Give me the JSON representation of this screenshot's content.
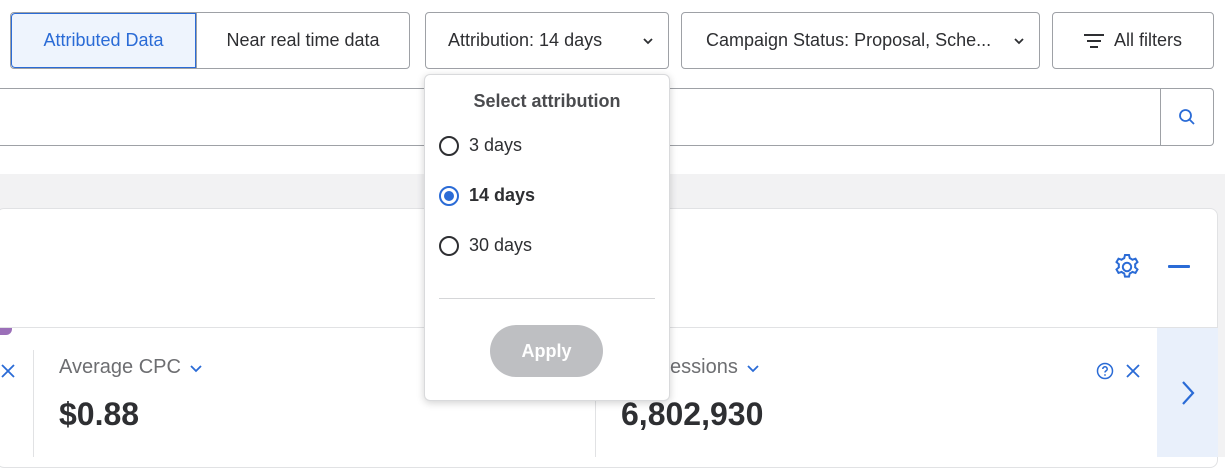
{
  "filters": {
    "segments": [
      "Attributed Data",
      "Near real time data"
    ],
    "attribution_label": "Attribution: 14 days",
    "campaign_status_label": "Campaign Status: Proposal, Sche...",
    "all_filters_label": "All filters"
  },
  "search": {
    "value": "",
    "placeholder": ""
  },
  "metrics": [
    {
      "label": "Average CPC",
      "value": "$0.88"
    },
    {
      "label": "essions",
      "value": "6,802,930"
    }
  ],
  "popover": {
    "title": "Select attribution",
    "options": [
      "3 days",
      "14 days",
      "30 days"
    ],
    "selected": "14 days",
    "apply_label": "Apply"
  },
  "icons": [
    "chevron-down-icon",
    "filter-lines-icon",
    "search-icon",
    "gear-icon",
    "minus-icon",
    "close-icon",
    "help-icon",
    "chevron-right-icon"
  ],
  "colors": {
    "accent": "#2a6bd6",
    "disabled": "#bebfc2",
    "highlight": "#eef4fd",
    "purple": "#9b6fb8"
  }
}
